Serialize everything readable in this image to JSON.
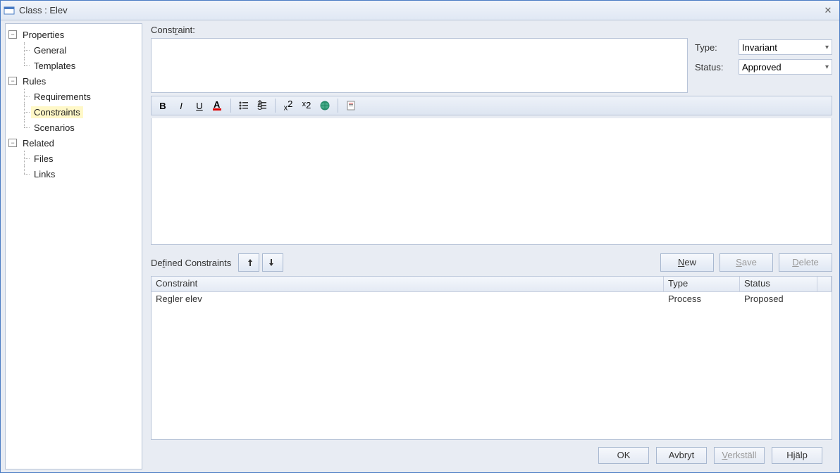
{
  "title": "Class : Elev",
  "tree": {
    "properties": {
      "label": "Properties",
      "general": "General",
      "templates": "Templates"
    },
    "rules": {
      "label": "Rules",
      "requirements": "Requirements",
      "constraints": "Constraints",
      "scenarios": "Scenarios"
    },
    "related": {
      "label": "Related",
      "files": "Files",
      "links": "Links"
    }
  },
  "labels": {
    "constraint": "Constraint:",
    "type": "Type:",
    "status": "Status:",
    "defined": "Defined Constraints"
  },
  "dropdowns": {
    "type_value": "Invariant",
    "status_value": "Approved"
  },
  "buttons": {
    "new": "New",
    "save": "Save",
    "delete": "Delete",
    "ok": "OK",
    "cancel": "Avbryt",
    "apply": "Verkställ",
    "help": "Hjälp"
  },
  "grid": {
    "headers": {
      "constraint": "Constraint",
      "type": "Type",
      "status": "Status"
    },
    "rows": [
      {
        "constraint": "Regler elev",
        "type": "Process",
        "status": "Proposed"
      }
    ]
  }
}
